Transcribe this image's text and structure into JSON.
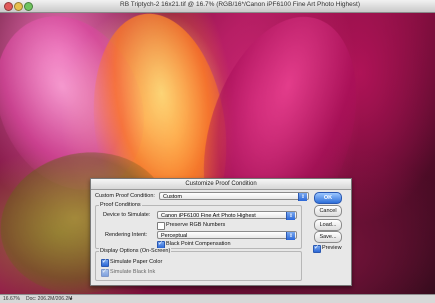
{
  "window": {
    "title": "RB Triptych-2 16x21.tif @ 16.7% (RGB/16*/Canon iPF6100 Fine Art Photo Highest)"
  },
  "status_bar": {
    "zoom": "16.67%",
    "doc_info": "Doc: 206.2M/206.2M"
  },
  "dialog": {
    "title": "Customize Proof Condition",
    "custom_proof_label": "Custom Proof Condition:",
    "custom_proof_value": "Custom",
    "proof_conditions_label": "Proof Conditions",
    "device_label": "Device to Simulate:",
    "device_value": "Canon iPF6100 Fine Art Photo Highest",
    "preserve_rgb_label": "Preserve RGB Numbers",
    "preserve_rgb_checked": false,
    "rendering_intent_label": "Rendering Intent:",
    "rendering_intent_value": "Perceptual",
    "black_point_label": "Black Point Compensation",
    "black_point_checked": true,
    "display_options_label": "Display Options (On-Screen)",
    "simulate_paper_label": "Simulate Paper Color",
    "simulate_paper_checked": true,
    "simulate_black_ink_label": "Simulate Black Ink",
    "simulate_black_ink_checked": true,
    "buttons": {
      "ok": "OK",
      "cancel": "Cancel",
      "load": "Load...",
      "save": "Save..."
    },
    "preview_label": "Preview",
    "preview_checked": true
  }
}
